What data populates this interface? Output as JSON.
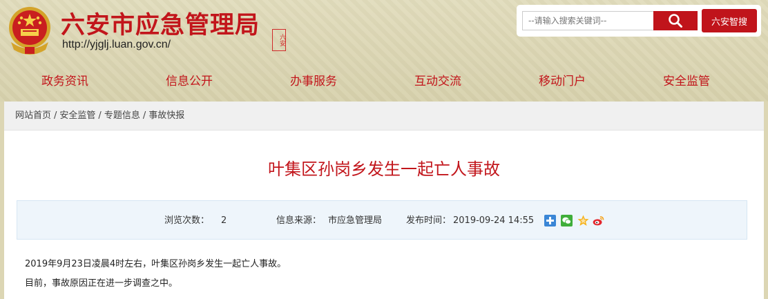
{
  "header": {
    "site_title": "六安市应急管理局",
    "site_url": "http://yjglj.luan.gov.cn/",
    "seal_text": "六安"
  },
  "search": {
    "placeholder": "--请输入搜索关键词--",
    "smart_button": "六安智搜"
  },
  "nav": {
    "items": [
      {
        "label": "政务资讯"
      },
      {
        "label": "信息公开"
      },
      {
        "label": "办事服务"
      },
      {
        "label": "互动交流"
      },
      {
        "label": "移动门户"
      },
      {
        "label": "安全监管"
      }
    ]
  },
  "breadcrumb": {
    "items": [
      "网站首页",
      "安全监管",
      "专题信息",
      "事故快报"
    ],
    "separator": "/"
  },
  "article": {
    "title": "叶集区孙岗乡发生一起亡人事故",
    "views_label": "浏览次数：",
    "views_value": "2",
    "source_label": "信息来源：",
    "source_value": "市应急管理局",
    "time_label": "发布时间：",
    "time_value": "2019-09-24 14:55",
    "paragraphs": [
      "2019年9月23日凌晨4时左右，叶集区孙岗乡发生一起亡人事故。",
      "目前，事故原因正在进一步调查之中。"
    ]
  },
  "share_icons": [
    "plus-share-icon",
    "wechat-icon",
    "qzone-star-icon",
    "weibo-icon"
  ],
  "colors": {
    "brand_red": "#c2151b",
    "header_bg": "#dcd6b4",
    "meta_bg": "#eef5fb"
  }
}
